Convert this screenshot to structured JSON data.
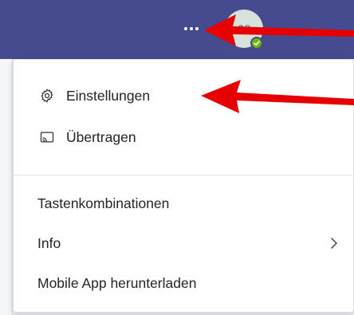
{
  "header": {
    "more_options_icon": "more-horizontal-icon",
    "avatar_initials": "CS",
    "presence_status": "available",
    "colors": {
      "bar": "#464a8f",
      "presence": "#6bb700"
    }
  },
  "menu": {
    "items": [
      {
        "label": "Einstellungen",
        "icon": "gear-icon"
      },
      {
        "label": "Übertragen",
        "icon": "cast-icon"
      },
      {
        "label": "Tastenkombinationen"
      },
      {
        "label": "Info",
        "icon": "chevron-right-icon"
      },
      {
        "label": "Mobile App herunterladen"
      }
    ]
  },
  "annotations": {
    "arrow_color": "#e60000"
  }
}
